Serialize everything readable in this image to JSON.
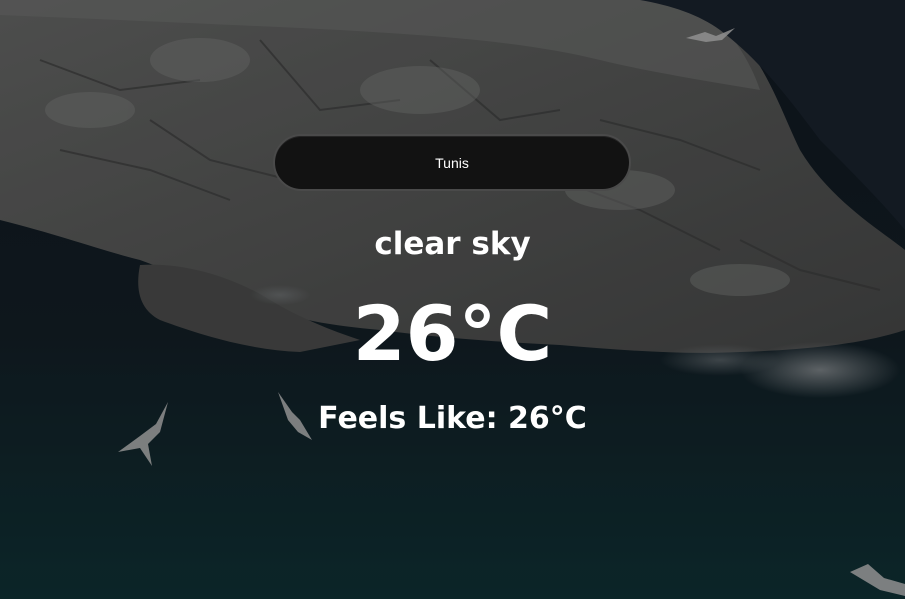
{
  "search": {
    "value": "Tunis"
  },
  "weather": {
    "description": "clear sky",
    "temperature": "26°C",
    "feels_like": "Feels Like: 26°C"
  },
  "colors": {
    "input_background": "#121212",
    "text": "#ffffff"
  }
}
